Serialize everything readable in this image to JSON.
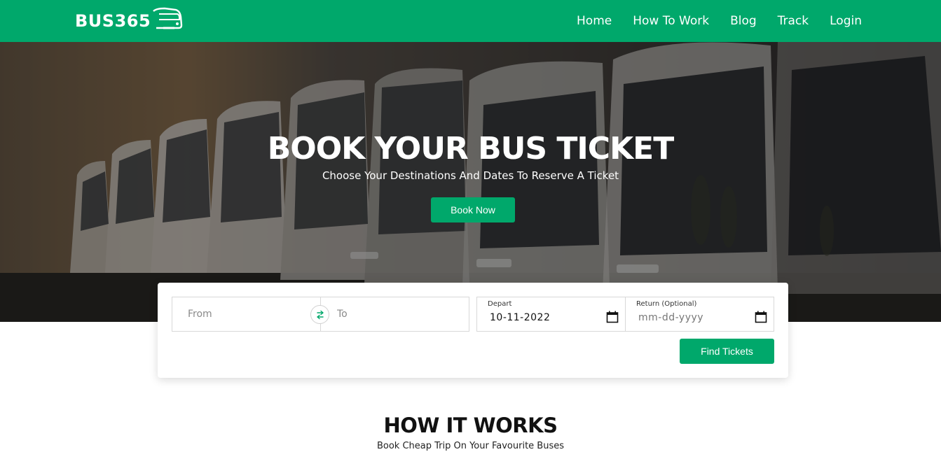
{
  "brand": {
    "name": "BUS365"
  },
  "nav": {
    "items": [
      {
        "label": "Home"
      },
      {
        "label": "How To Work"
      },
      {
        "label": "Blog"
      },
      {
        "label": "Track"
      },
      {
        "label": "Login"
      }
    ]
  },
  "hero": {
    "title": "BOOK YOUR BUS TICKET",
    "subtitle": "Choose Your Destinations And Dates To Reserve A Ticket",
    "cta_label": "Book Now"
  },
  "search": {
    "from_placeholder": "From",
    "to_placeholder": "To",
    "depart_label": "Depart",
    "depart_value": "10-11-2022",
    "return_label": "Return (Optional)",
    "return_placeholder": "mm-dd-yyyy",
    "submit_label": "Find Tickets"
  },
  "how_it_works": {
    "title": "HOW IT WORKS",
    "subtitle": "Book Cheap Trip On Your Favourite Buses"
  },
  "colors": {
    "brand_green": "#00a86b",
    "hero_dark": "#1c1d1f",
    "text_dark": "#111111"
  },
  "icons": {
    "swap": "swap-arrows-icon",
    "calendar": "calendar-icon",
    "logo": "bus-icon"
  }
}
